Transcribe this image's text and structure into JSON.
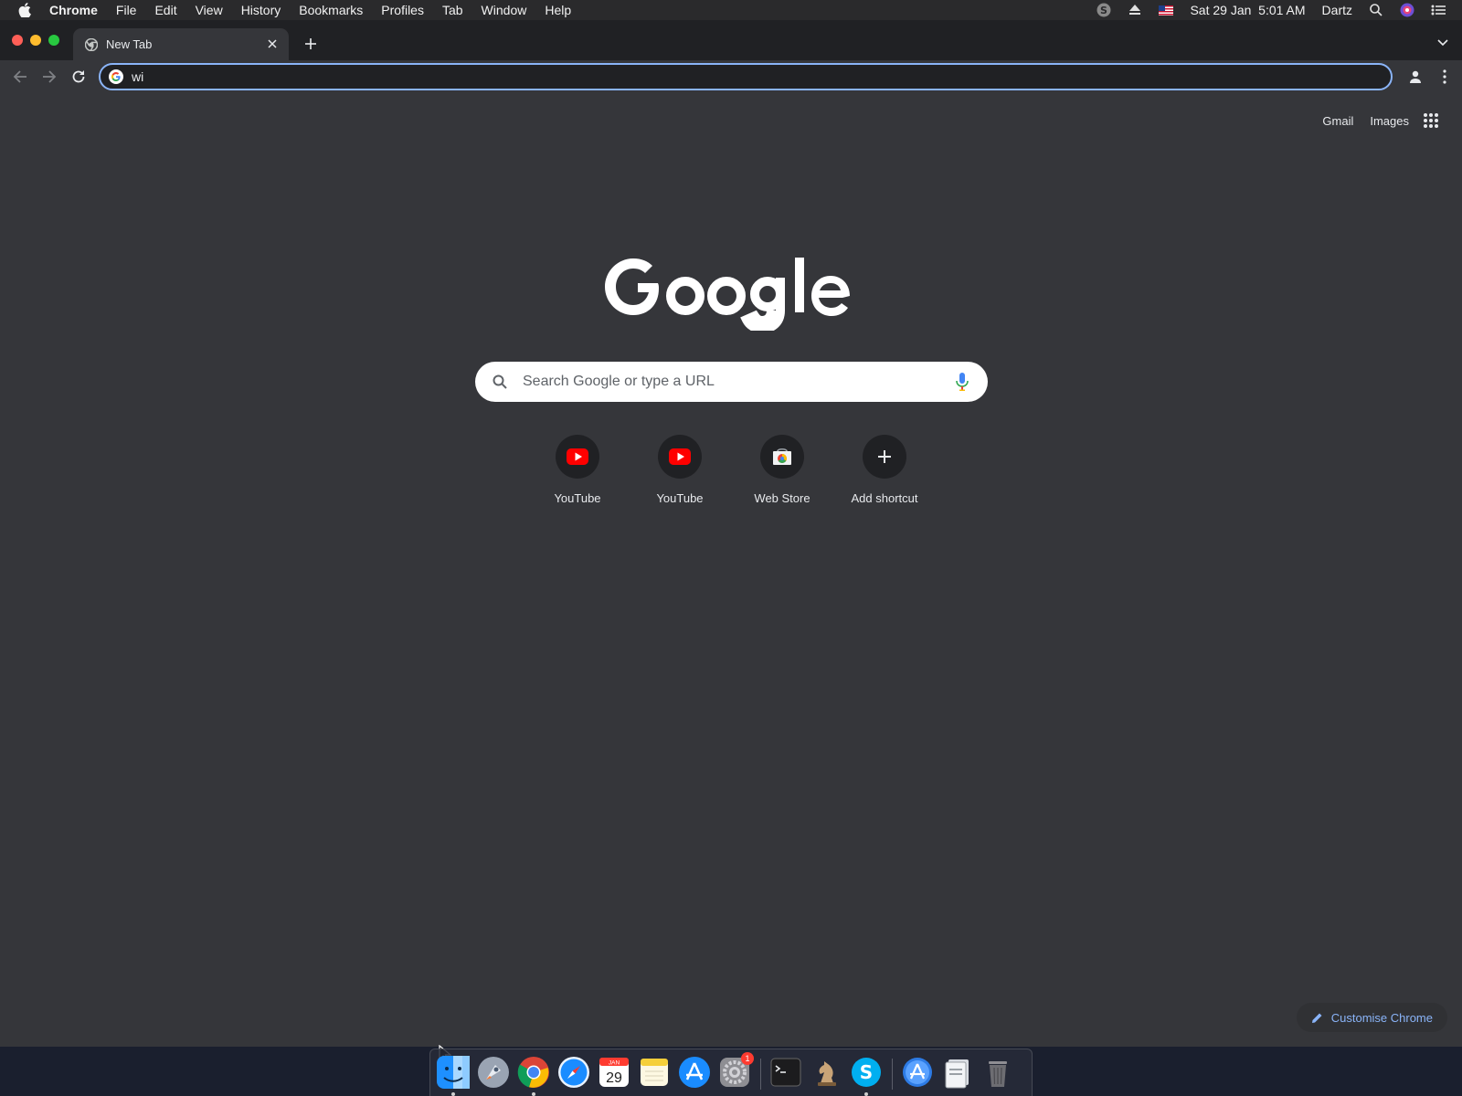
{
  "menubar": {
    "app_name": "Chrome",
    "items": [
      "File",
      "Edit",
      "View",
      "History",
      "Bookmarks",
      "Profiles",
      "Tab",
      "Window",
      "Help"
    ],
    "datetime": "Sat 29 Jan  5:01 AM",
    "user": "Dartz"
  },
  "tabs": [
    {
      "title": "New Tab"
    }
  ],
  "omnibox": {
    "value": "wi"
  },
  "ntp": {
    "links": {
      "gmail": "Gmail",
      "images": "Images"
    },
    "search": {
      "placeholder": "Search Google or type a URL"
    },
    "shortcuts": [
      {
        "label": "YouTube",
        "icon": "youtube-icon"
      },
      {
        "label": "YouTube",
        "icon": "youtube-icon"
      },
      {
        "label": "Web Store",
        "icon": "web-store-icon"
      },
      {
        "label": "Add shortcut",
        "icon": "plus-icon"
      }
    ],
    "customise_label": "Customise Chrome"
  },
  "dock": {
    "calendar_day": "29",
    "calendar_month": "JAN",
    "settings_badge": "1"
  },
  "colors": {
    "accent": "#8ab4f8",
    "ntp_background": "#35363a",
    "youtube_red": "#ff0000"
  }
}
